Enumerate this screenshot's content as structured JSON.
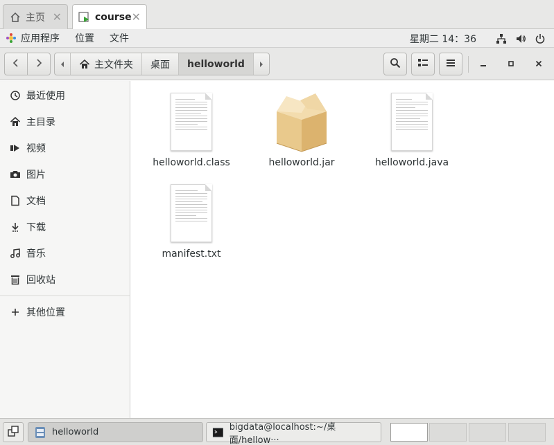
{
  "tabs": [
    {
      "label": "主页",
      "icon": "home-icon",
      "active": false
    },
    {
      "label": "course",
      "icon": "terminal-play-icon",
      "active": true
    }
  ],
  "menubar": {
    "apps": "应用程序",
    "places": "位置",
    "file": "文件",
    "clock": "星期二 14：36"
  },
  "path": {
    "home": "主文件夹",
    "desktop": "桌面",
    "current": "helloworld"
  },
  "sidebar": [
    {
      "label": "最近使用",
      "icon": "clock-icon"
    },
    {
      "label": "主目录",
      "icon": "home-icon"
    },
    {
      "label": "视频",
      "icon": "video-icon"
    },
    {
      "label": "图片",
      "icon": "camera-icon"
    },
    {
      "label": "文档",
      "icon": "document-icon"
    },
    {
      "label": "下载",
      "icon": "download-icon"
    },
    {
      "label": "音乐",
      "icon": "music-icon"
    },
    {
      "label": "回收站",
      "icon": "trash-icon"
    },
    {
      "label": "其他位置",
      "icon": "plus-icon"
    }
  ],
  "files": [
    {
      "name": "helloworld.class",
      "type": "text"
    },
    {
      "name": "helloworld.jar",
      "type": "package"
    },
    {
      "name": "helloworld.java",
      "type": "text"
    },
    {
      "name": "manifest.txt",
      "type": "text"
    }
  ],
  "taskbar": {
    "task1": "helloworld",
    "task2": "bigdata@localhost:~/桌面/hellow···"
  },
  "colors": {
    "accent": "#4a90d9",
    "chrome": "#e8e8e7",
    "sidebar_bg": "#f6f6f5"
  }
}
